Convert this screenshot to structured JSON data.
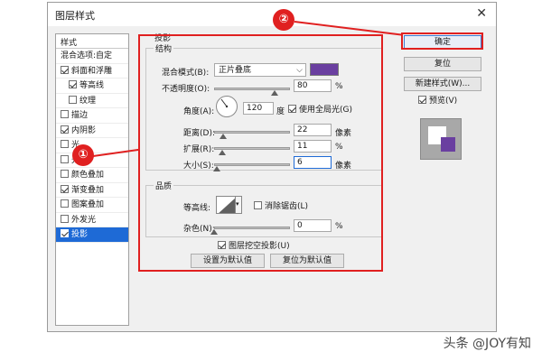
{
  "dialog": {
    "title": "图层样式",
    "close_glyph": "✕"
  },
  "style_list": {
    "header": "样式",
    "items": [
      {
        "label": "混合选项:自定",
        "checkbox": false,
        "checked": false,
        "sub": false,
        "selected": false
      },
      {
        "label": "斜面和浮雕",
        "checkbox": true,
        "checked": true,
        "sub": false,
        "selected": false
      },
      {
        "label": "等高线",
        "checkbox": true,
        "checked": true,
        "sub": true,
        "selected": false
      },
      {
        "label": "纹理",
        "checkbox": true,
        "checked": false,
        "sub": true,
        "selected": false
      },
      {
        "label": "描边",
        "checkbox": true,
        "checked": false,
        "sub": false,
        "selected": false
      },
      {
        "label": "内阴影",
        "checkbox": true,
        "checked": true,
        "sub": false,
        "selected": false
      },
      {
        "label": "光",
        "checkbox": true,
        "checked": false,
        "sub": false,
        "selected": false
      },
      {
        "label": "光泽",
        "checkbox": true,
        "checked": false,
        "sub": false,
        "selected": false
      },
      {
        "label": "颜色叠加",
        "checkbox": true,
        "checked": false,
        "sub": false,
        "selected": false
      },
      {
        "label": "渐变叠加",
        "checkbox": true,
        "checked": true,
        "sub": false,
        "selected": false
      },
      {
        "label": "图案叠加",
        "checkbox": true,
        "checked": false,
        "sub": false,
        "selected": false
      },
      {
        "label": "外发光",
        "checkbox": true,
        "checked": false,
        "sub": false,
        "selected": false
      },
      {
        "label": "投影",
        "checkbox": true,
        "checked": true,
        "sub": false,
        "selected": true
      }
    ]
  },
  "shadow": {
    "section_title": "投影",
    "structure_title": "结构",
    "blend_mode_label": "混合模式(B):",
    "blend_mode_value": "正片叠底",
    "shadow_color": "#6a3fa0",
    "opacity_label": "不透明度(O):",
    "opacity_value": "80",
    "opacity_unit": "%",
    "opacity_fraction": 0.8,
    "angle_label": "角度(A):",
    "angle_value": "120",
    "angle_unit": "度",
    "global_light_label": "使用全局光(G)",
    "global_light_checked": true,
    "distance_label": "距离(D):",
    "distance_value": "22",
    "distance_unit": "像素",
    "distance_fraction": 0.12,
    "spread_label": "扩展(R):",
    "spread_value": "11",
    "spread_unit": "%",
    "spread_fraction": 0.11,
    "size_label": "大小(S):",
    "size_value": "6",
    "size_unit": "像素",
    "size_fraction": 0.03,
    "quality_title": "品质",
    "contour_label": "等高线:",
    "antialias_label": "消除锯齿(L)",
    "antialias_checked": false,
    "noise_label": "杂色(N):",
    "noise_value": "0",
    "noise_unit": "%",
    "noise_fraction": 0.0,
    "knockout_label": "图层挖空投影(U)",
    "knockout_checked": true,
    "set_default_label": "设置为默认值",
    "reset_default_label": "复位为默认值"
  },
  "right_panel": {
    "ok_label": "确定",
    "reset_label": "复位",
    "new_style_label": "新建样式(W)...",
    "preview_label": "预览(V)",
    "preview_checked": true
  },
  "annotations": {
    "marker_1": "①",
    "marker_2": "②",
    "accent_color": "#e02020"
  },
  "watermark": "头条 @JOY有知"
}
